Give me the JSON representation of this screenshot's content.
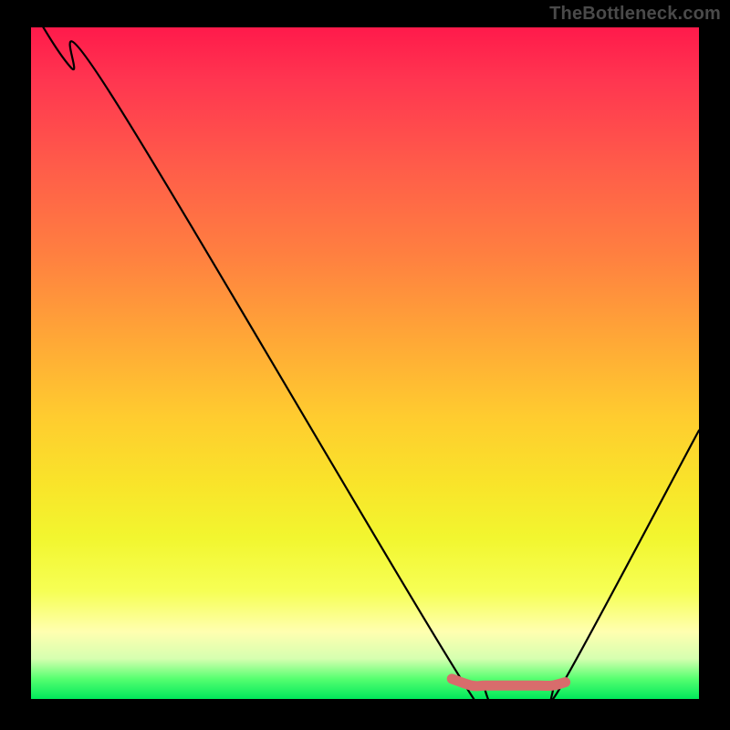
{
  "watermark": "TheBottleneck.com",
  "chart_data": {
    "type": "line",
    "title": "",
    "xlabel": "",
    "ylabel": "",
    "xlim": [
      0,
      100
    ],
    "ylim": [
      0,
      100
    ],
    "series": [
      {
        "name": "curve",
        "x": [
          0,
          6,
          12,
          65,
          68,
          71,
          75,
          78,
          80,
          100
        ],
        "values": [
          103,
          94,
          90,
          2,
          2,
          2,
          2,
          2,
          3,
          40
        ]
      }
    ],
    "marker": {
      "name": "highlight-segment",
      "color": "#d86c6c",
      "x": [
        63,
        66,
        68,
        72,
        76,
        78,
        80
      ],
      "values": [
        3,
        2,
        2,
        2,
        2,
        2,
        2.5
      ]
    },
    "gradient_stops": [
      {
        "pos": 0,
        "color": "#ff1a4b"
      },
      {
        "pos": 34,
        "color": "#ff8040"
      },
      {
        "pos": 58,
        "color": "#ffcc2f"
      },
      {
        "pos": 84,
        "color": "#f6ff55"
      },
      {
        "pos": 97,
        "color": "#56ff70"
      },
      {
        "pos": 100,
        "color": "#00e85b"
      }
    ]
  }
}
